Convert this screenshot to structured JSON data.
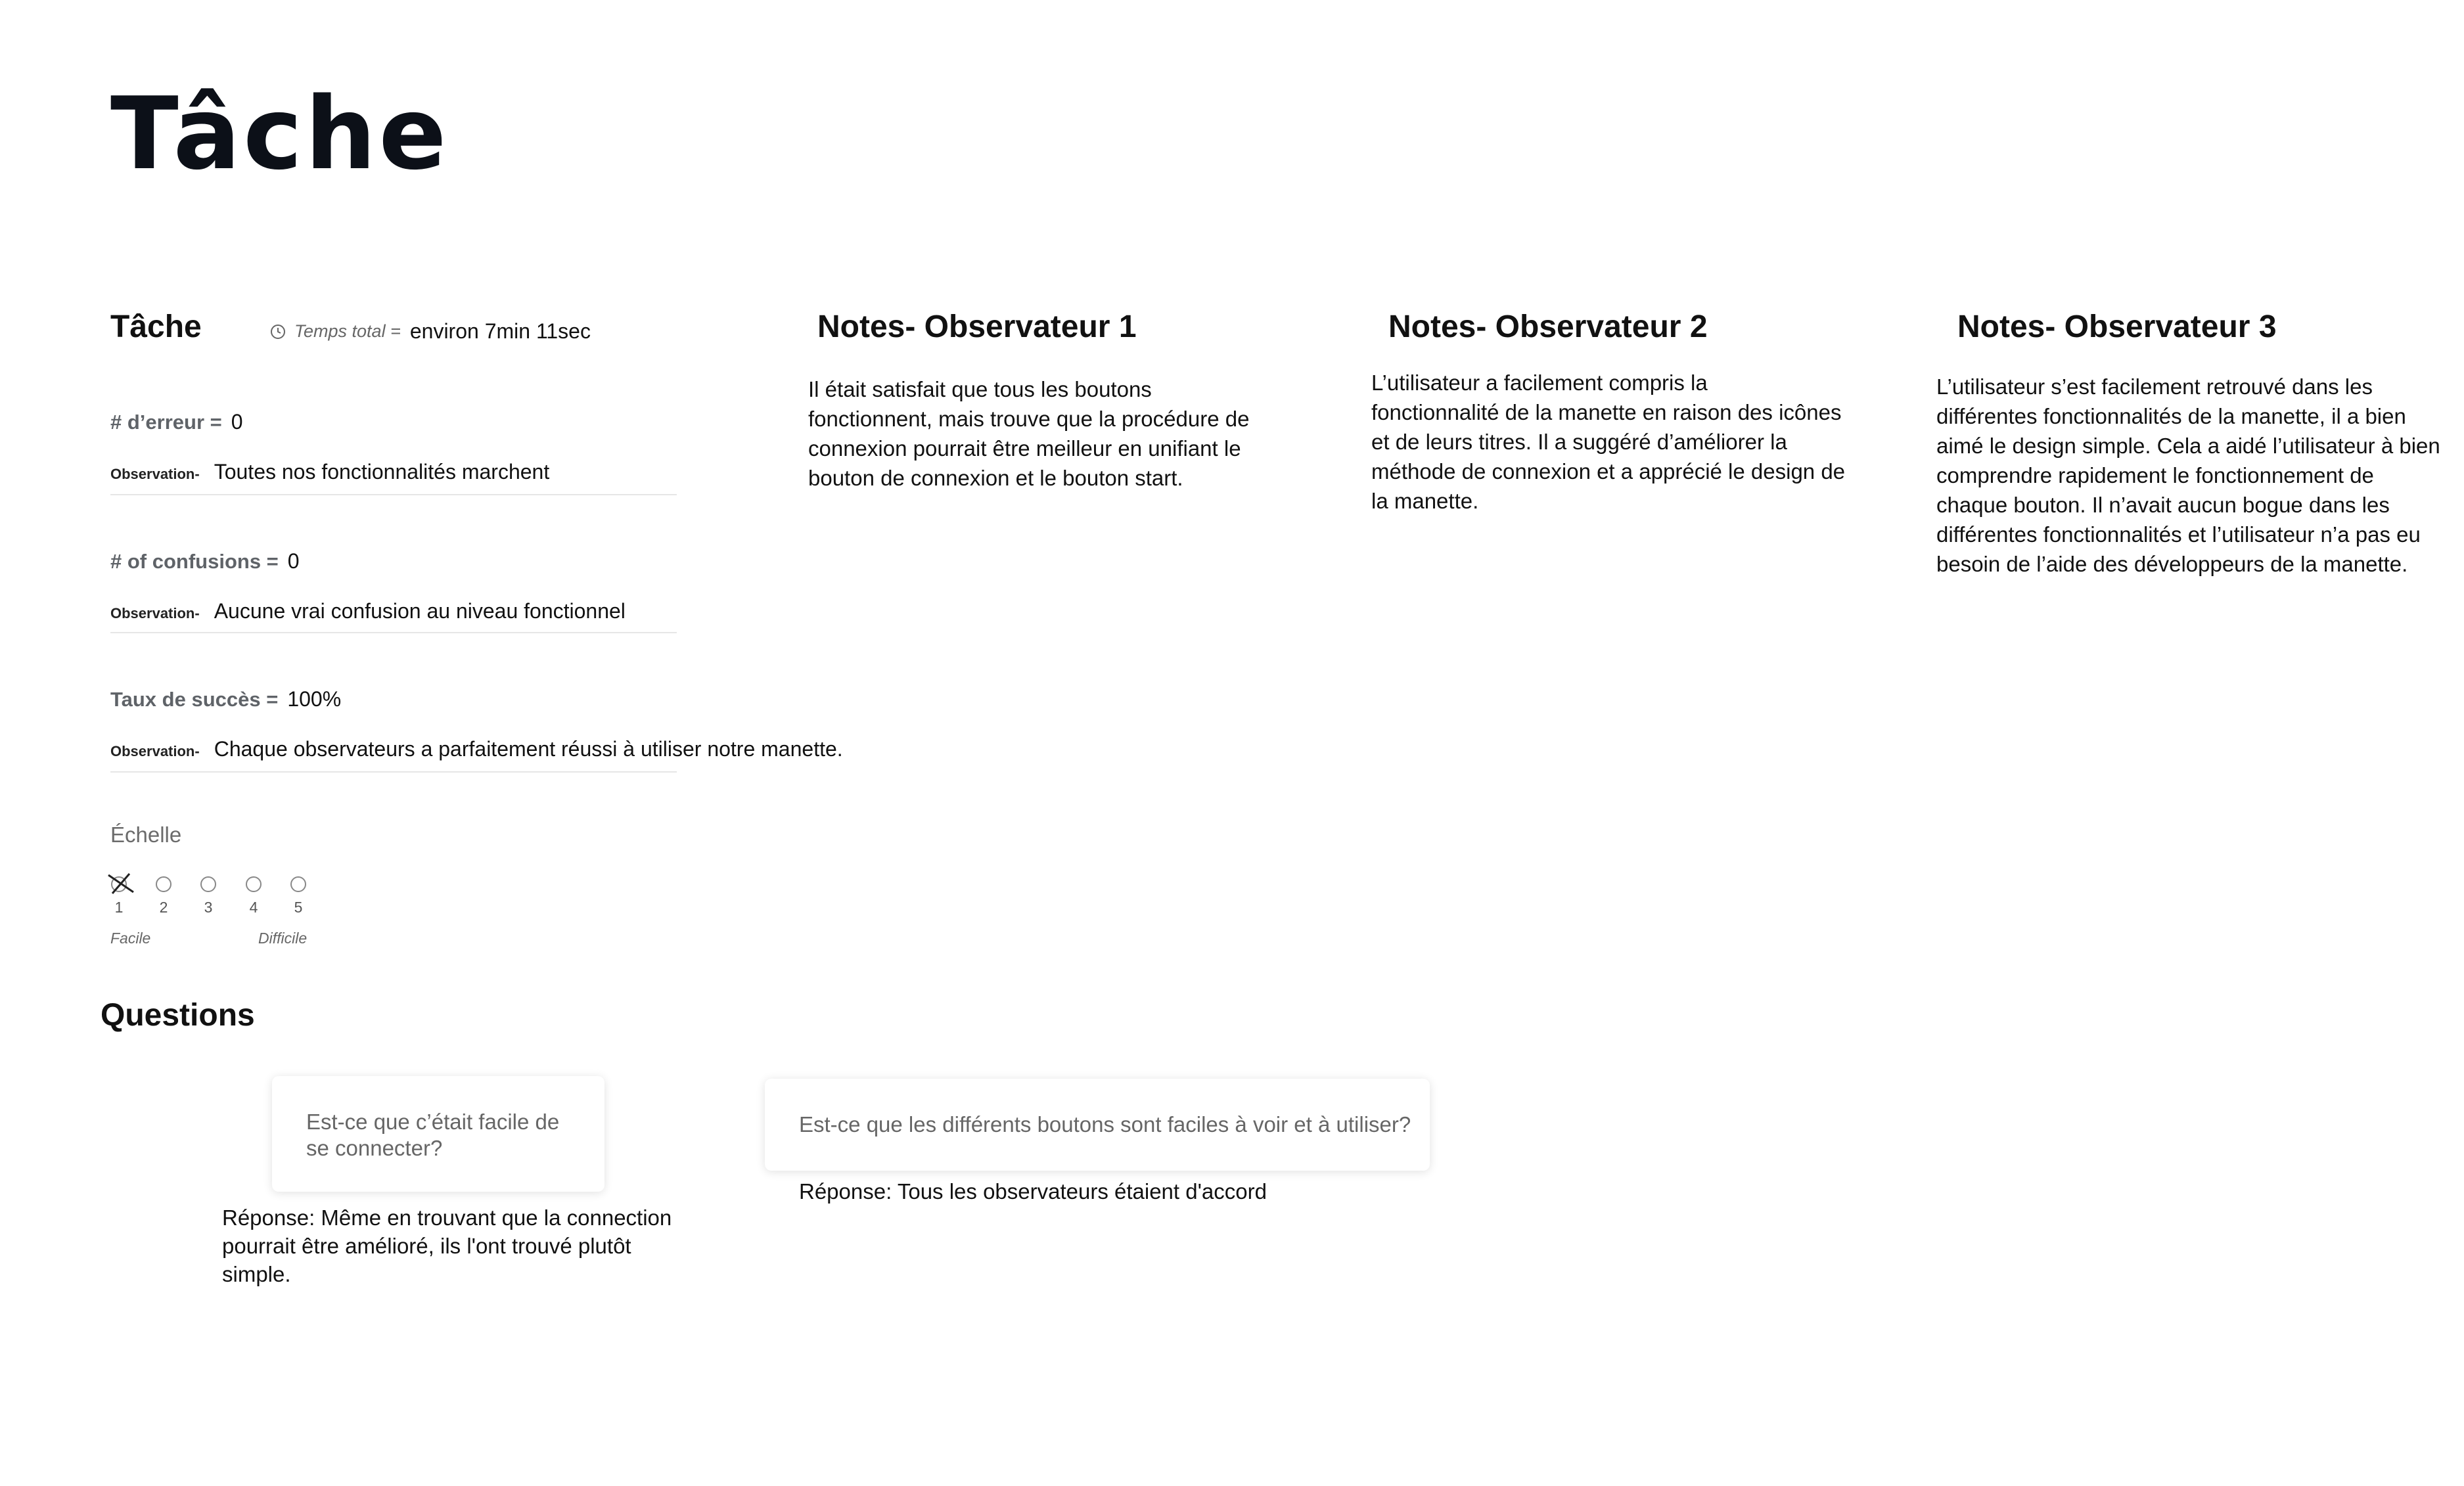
{
  "page_title": "Tâche",
  "task": {
    "heading": "Tâche",
    "time_label": "Temps total =",
    "time_value": "environ 7min 11sec",
    "errors_label": "# d’erreur =",
    "errors_value": "0",
    "errors_observation_label": "Observation-",
    "errors_observation": "Toutes nos fonctionnalités marchent",
    "confusions_label": "# of confusions =",
    "confusions_value": "0",
    "confusions_observation_label": "Observation-",
    "confusions_observation": "Aucune vrai confusion au niveau fonctionnel",
    "success_label": "Taux de succès =",
    "success_value": "100%",
    "success_observation_label": "Observation-",
    "success_observation": "Chaque observateurs a parfaitement réussi à utiliser notre manette."
  },
  "scale": {
    "title": "Échelle",
    "options": [
      "1",
      "2",
      "3",
      "4",
      "5"
    ],
    "selected": "1",
    "low_label": "Facile",
    "high_label": "Difficile"
  },
  "observers": [
    {
      "heading": "Notes- Observateur 1",
      "lines": [
        "Il était satisfait que tous les boutons",
        "fonctionnent, mais trouve que la procédure de",
        "connexion pourrait être meilleur en unifiant le",
        "bouton de connexion et le bouton start."
      ]
    },
    {
      "heading": "Notes- Observateur 2",
      "lines": [
        "L’utilisateur a facilement compris la",
        "fonctionnalité de la manette en raison des icônes",
        "et de leurs titres. Il a suggéré d’améliorer la",
        "méthode de connexion et a apprécié le design de",
        "la manette."
      ]
    },
    {
      "heading": "Notes- Observateur 3",
      "lines": [
        "L’utilisateur s’est facilement retrouvé dans les",
        "différentes fonctionnalités de la manette, il a bien",
        "aimé le design simple. Cela a aidé l’utilisateur à bien",
        "comprendre rapidement le fonctionnement de",
        "chaque bouton. Il n’avait aucun bogue dans les",
        "différentes fonctionnalités et l’utilisateur n’a pas eu",
        "besoin de l’aide des développeurs de la manette."
      ]
    }
  ],
  "questions": {
    "heading": "Questions",
    "items": [
      {
        "question_lines": [
          "Est-ce que c’était facile de",
          "se connecter?"
        ],
        "answer_lines": [
          "Réponse: Même en trouvant que la connection",
          "pourrait être amélioré, ils l'ont trouvé plutôt",
          "simple."
        ]
      },
      {
        "question_lines": [
          "Est-ce que les différents boutons sont faciles à voir et à utiliser?"
        ],
        "answer_lines": [
          "Réponse: Tous les observateurs étaient d'accord"
        ]
      }
    ]
  }
}
